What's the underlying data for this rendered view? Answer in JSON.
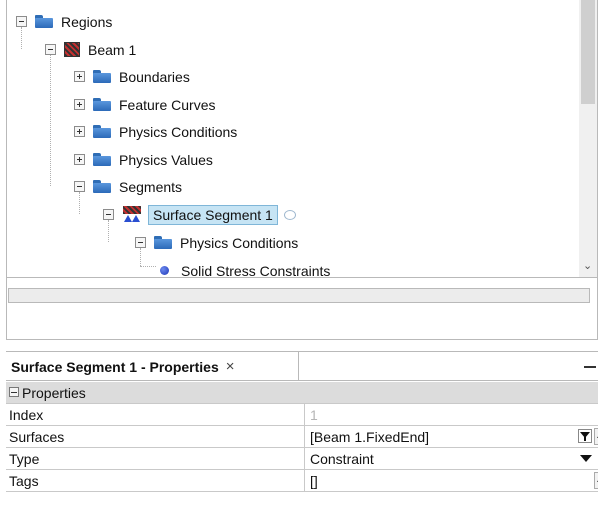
{
  "tree": {
    "items": [
      {
        "label": "Regions"
      },
      {
        "label": "Beam 1"
      },
      {
        "label": "Boundaries"
      },
      {
        "label": "Feature Curves"
      },
      {
        "label": "Physics Conditions"
      },
      {
        "label": "Physics Values"
      },
      {
        "label": "Segments"
      },
      {
        "label": "Surface Segment 1"
      },
      {
        "label": "Physics Conditions"
      },
      {
        "label": "Solid Stress Constraints"
      }
    ]
  },
  "properties_panel": {
    "tab_title": "Surface Segment 1 - Properties",
    "close_glyph": "×",
    "group_label": "Properties",
    "rows": [
      {
        "key": "Index",
        "value": "1"
      },
      {
        "key": "Surfaces",
        "value": "[Beam 1.FixedEnd]",
        "button": "..."
      },
      {
        "key": "Type",
        "value": "Constraint"
      },
      {
        "key": "Tags",
        "value": "[]",
        "button": "..."
      }
    ]
  },
  "colors": {
    "selection_bg": "#c6e4f4",
    "folder_blue": "#2c6ab8",
    "group_header_bg": "#dcdcdc"
  }
}
